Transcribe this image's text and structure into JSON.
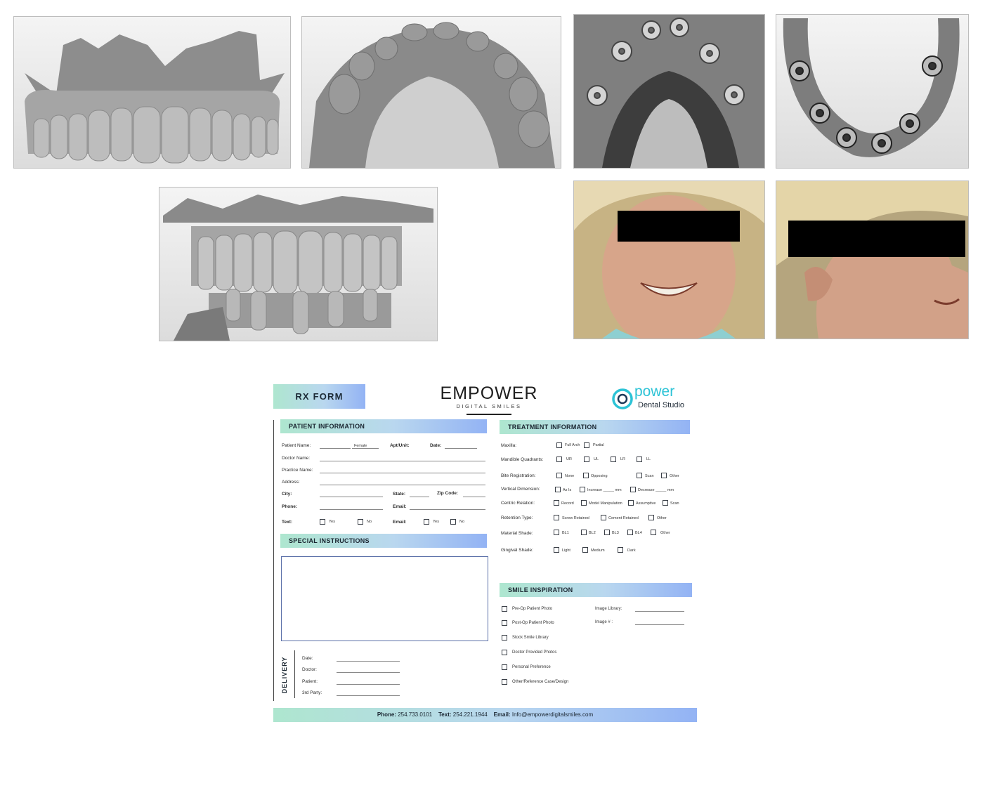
{
  "images": {
    "scan1": "upper-denture-frontal-scan",
    "scan2": "upper-arch-occlusal-scan",
    "scan3": "maxilla-implant-scan",
    "scan4": "mandible-implant-scan",
    "scan5": "occlusion-frontal-scan",
    "photo1": "patient-frontal-smile-photo",
    "photo2": "patient-profile-photo"
  },
  "form": {
    "title": "RX FORM",
    "brand": {
      "name": "EMPOWER",
      "tagline": "DIGITAL SMILES"
    },
    "partner": {
      "name": "power",
      "sub": "Dental Studio"
    },
    "patient": {
      "header": "PATIENT INFORMATION",
      "patient_name": "Patient Name:",
      "female": "Female",
      "apt": "Apt/Unit:",
      "date": "Date:",
      "doctor_name": "Doctor Name:",
      "practice_name": "Practice Name:",
      "address": "Address:",
      "city": "City:",
      "state": "State:",
      "zip": "Zip Code:",
      "phone": "Phone:",
      "email": "Email:",
      "text": "Text:",
      "email2": "Email:",
      "yes": "Yes",
      "no": "No",
      "yes2": "Yes",
      "no2": "No"
    },
    "special": {
      "header": "SPECIAL INSTRUCTIONS"
    },
    "delivery": {
      "label": "DELIVERY",
      "date": "Date:",
      "doctor": "Doctor:",
      "patient": "Patient:",
      "third": "3rd Party:"
    },
    "treatment": {
      "header": "TREATMENT INFORMATION",
      "maxilla": "Maxilla:",
      "maxilla_opts": [
        "Full Arch",
        "Partial"
      ],
      "mandible": "Mandible Quadrants:",
      "mandible_opts": [
        "UR",
        "UL",
        "LR",
        "LL"
      ],
      "bite": "Bite Registration:",
      "bite_opts": [
        "None",
        "Opposing",
        "Scan",
        "Other"
      ],
      "vertical": "Vertical Dimension:",
      "vertical_opts": [
        "As Is",
        "Increase _____ mm",
        "Decrease _____ mm"
      ],
      "centric": "Centric Relation:",
      "centric_opts": [
        "Record",
        "Model Manipulation",
        "Assumptive",
        "Scan"
      ],
      "retention": "Retention Type:",
      "retention_opts": [
        "Screw Retained",
        "Cement Retained",
        "Other"
      ],
      "material": "Material Shade:",
      "material_opts": [
        "BL1",
        "BL2",
        "BL3",
        "BL4",
        "Other"
      ],
      "gingival": "Gingival Shade:",
      "gingival_opts": [
        "Light",
        "Medium",
        "Dark"
      ]
    },
    "smile": {
      "header": "SMILE INSPIRATION",
      "items": [
        "Pre-Op Patient Photo",
        "Post-Op Patient Photo",
        "Stock Smile Library",
        "Doctor Provided Photos",
        "Personal Preference",
        "Other/Reference Case/Design"
      ],
      "image_library": "Image Library:",
      "image_num": "Image # :"
    },
    "footer": {
      "phone_label": "Phone:",
      "phone": "254.733.0101",
      "text_label": "Text:",
      "text": "254.221.1944",
      "email_label": "Email:",
      "email": "Info@empowerdigitalsmiles.com"
    }
  },
  "colors": {
    "accent_green": "#aee6cf",
    "accent_blue": "#93b3f4",
    "brand_teal": "#2cc3d6",
    "redaction": "#000000"
  }
}
